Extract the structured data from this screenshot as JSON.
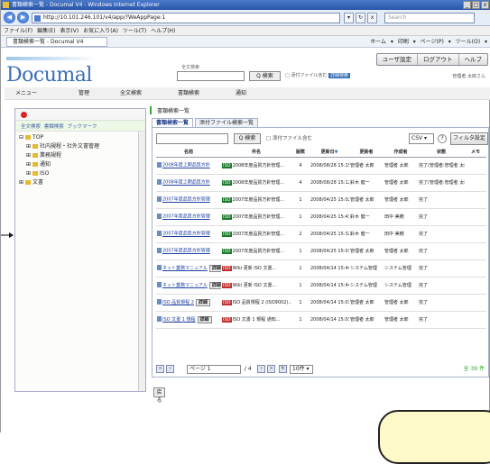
{
  "browser": {
    "window_title": "書類検索一覧 - Documal V4 - Windows Internet Explorer",
    "window_buttons": [
      "_",
      "□",
      "x"
    ],
    "address": "http://10.101.246.101/v4/app/?WeAppPage:1",
    "search_placeholder": "Search",
    "address_icons": [
      "▾",
      "↻",
      "x"
    ],
    "menu": [
      "ファイル(F)",
      "編集(E)",
      "表示(V)",
      "お気に入り(A)",
      "ツール(T)",
      "ヘルプ(H)"
    ],
    "tab_label": "書類検索一覧 - Documal V4",
    "toolbar_right": "ホーム ▾ 印刷 ▾ ページ(P) ▾ ツール(O) ▾"
  },
  "app": {
    "logo": "Documal",
    "quick_search_label": "全文検索",
    "quick_search_button": "Q 検索",
    "quick_search_option": "添付ファイル含む",
    "quick_search_badge": "詳細検索",
    "user_settings": "ユーザ設定",
    "logout": "ログアウト",
    "help": "ヘルプ",
    "user_line": "管理者 太郎さん",
    "nav": [
      "メニュー",
      "管理",
      "全文検索",
      "書類検索",
      "通知"
    ]
  },
  "left": {
    "tabs": "全文検索 書類検索 ブックマーク",
    "tree": [
      "TOP",
      "社内規程・社外文書管理",
      "業務規程",
      "通知",
      "ISO",
      "文書"
    ]
  },
  "main": {
    "breadcrumb": "書類検索一覧",
    "tabs": [
      "書類検索一覧",
      "添付ファイル検索一覧"
    ],
    "search_button": "Q 検索",
    "attach_option": "添付ファイル含む",
    "export_format": "CSV",
    "help_icon": "?",
    "filter_button": "フィルタ設定",
    "columns": [
      "名前",
      "件名",
      "版数",
      "更新日",
      "更新者",
      "作成者",
      "状態",
      "メモ"
    ],
    "rows": [
      {
        "name": "2008年度上期品質方針",
        "tag": "",
        "subject": "2008年度品質方針管理...",
        "ver": "4",
        "date": "2008/08/28 15:15:06",
        "updater": "管理者 太郎",
        "creator": "管理者 太郎",
        "status": "完了(管理者:管理者 太郎)",
        "memo": ""
      },
      {
        "name": "2008年度上期品質方針",
        "tag": "",
        "subject": "2008年度品質方針管理...",
        "ver": "4",
        "date": "2008/08/28 15:12:44",
        "updater": "鈴木 健一",
        "creator": "管理者 太郎",
        "status": "完了(管理者:管理者 太郎)",
        "memo": ""
      },
      {
        "name": "2007年度品質方針管理",
        "tag": "",
        "subject": "2007年度品質方針管理...",
        "ver": "1",
        "date": "2008/04/25 15:02:25",
        "updater": "管理者 太郎",
        "creator": "管理者 太郎",
        "status": "完了",
        "memo": ""
      },
      {
        "name": "2007年度品質方針管理",
        "tag": "",
        "subject": "2007年度品質方針管理...",
        "ver": "1",
        "date": "2008/04/25 15:43:40",
        "updater": "鈴木 健一",
        "creator": "田中 美穂",
        "status": "完了",
        "memo": ""
      },
      {
        "name": "2007年度品質方針管理",
        "tag": "",
        "subject": "2007年度品質方針管理...",
        "ver": "2",
        "date": "2008/04/25 15:32:41",
        "updater": "鈴木 健一",
        "creator": "田中 美穂",
        "status": "完了",
        "memo": ""
      },
      {
        "name": "2007年度品質方針管理",
        "tag": "",
        "subject": "2007年度品質方針管理...",
        "ver": "1",
        "date": "2008/04/25 15:03:25",
        "updater": "管理者 太郎",
        "creator": "管理者 太郎",
        "status": "完了",
        "memo": ""
      },
      {
        "name": "ネット業務マニュアル",
        "tag": "詳細",
        "subject": "Wiki 更新 ISO 文書...",
        "ver": "1",
        "date": "2008/04/14 15:44:27",
        "updater": "システム管理",
        "creator": "システム管理",
        "status": "完了",
        "memo": ""
      },
      {
        "name": "ネット業務マニュアル",
        "tag": "詳細",
        "subject": "Wiki 更新 ISO 文書...",
        "ver": "1",
        "date": "2008/04/14 15:44:25",
        "updater": "システム管理",
        "creator": "システム管理",
        "status": "完了",
        "memo": ""
      },
      {
        "name": "ISO 品質規程 2",
        "tag": "詳細",
        "subject": "ISO 品質規程 2 (ISO9002)...",
        "ver": "1",
        "date": "2008/04/14 15:03:21",
        "updater": "管理者 太郎",
        "creator": "管理者 太郎",
        "status": "完了",
        "memo": ""
      },
      {
        "name": "ISO 文書 1 規程",
        "tag": "詳細",
        "subject": "ISO 文書 1 規程 通知...",
        "ver": "1",
        "date": "2008/04/14 15:03:21",
        "updater": "管理者 太郎",
        "creator": "管理者 太郎",
        "status": "完了",
        "memo": ""
      }
    ],
    "pager_page": "ページ 1",
    "pager_of": "/ 4",
    "page_size": "10件",
    "total": "全 39 件",
    "back_button": "戻る"
  }
}
